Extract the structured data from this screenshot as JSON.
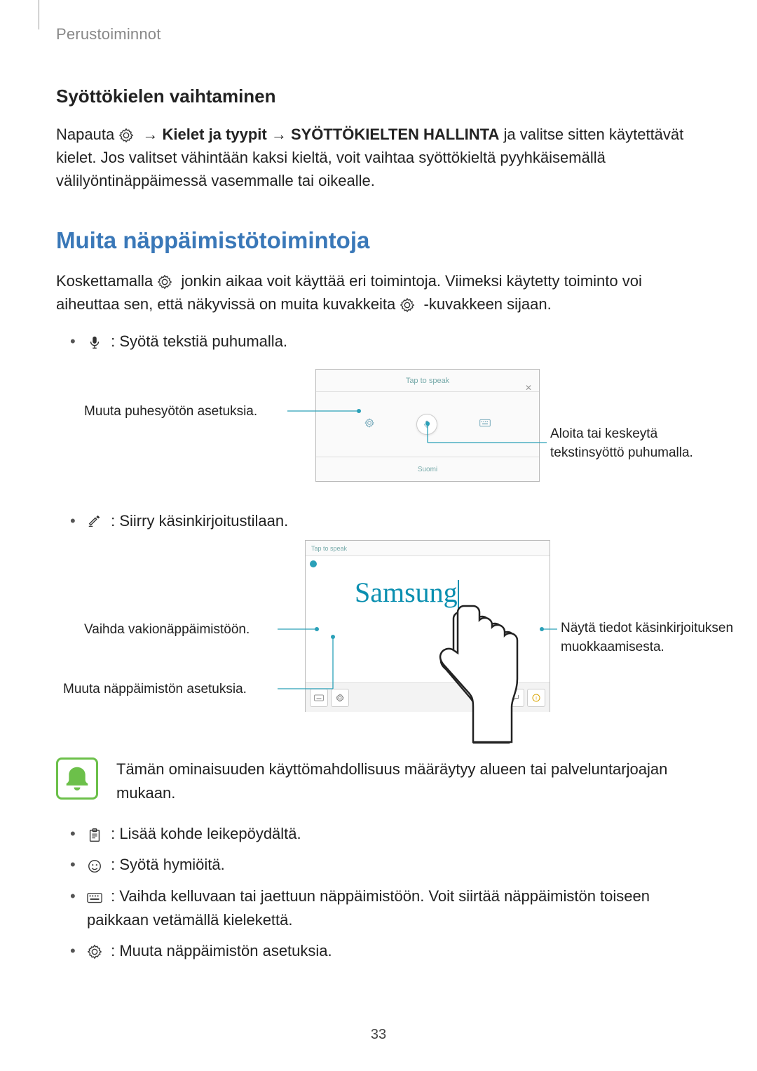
{
  "header": "Perustoiminnot",
  "sub_heading": "Syöttökielen vaihtaminen",
  "p1_a": "Napauta ",
  "p1_b": " → ",
  "p1_bold1": "Kielet ja tyypit",
  "p1_c": " → ",
  "p1_bold2": "SYÖTTÖKIELTEN HALLINTA",
  "p1_d": " ja valitse sitten käytettävät kielet. Jos valitset vähintään kaksi kieltä, voit vaihtaa syöttökieltä pyyhkäisemällä välilyöntinäppäimessä vasemmalle tai oikealle.",
  "section_heading": "Muita näppäimistötoimintoja",
  "p2_a": "Koskettamalla ",
  "p2_b": " jonkin aikaa voit käyttää eri toimintoja. Viimeksi käytetty toiminto voi aiheuttaa sen, että näkyvissä on muita kuvakkeita ",
  "p2_c": "-kuvakkeen sijaan.",
  "li_voice": " : Syötä tekstiä puhumalla.",
  "voice_panel": {
    "top": "Tap to speak",
    "bottom": "Suomi"
  },
  "callouts": {
    "voice_left": "Muuta puhesyötön asetuksia.",
    "voice_right": "Aloita tai keskeytä tekstinsyöttö puhumalla."
  },
  "li_hw": " : Siirry käsinkirjoitustilaan.",
  "hw_panel": {
    "top": "Tap to speak",
    "text": "Samsung"
  },
  "callouts2": {
    "hw_left_top": "Vaihda vakionäppäimistöön.",
    "hw_left_bot": "Muuta näppäimistön asetuksia.",
    "hw_right": "Näytä tiedot käsinkirjoituksen muokkaamisesta."
  },
  "note": "Tämän ominaisuuden käyttömahdollisuus määräytyy alueen tai palveluntarjoajan mukaan.",
  "li_clip": " : Lisää kohde leikepöydältä.",
  "li_emoji": " : Syötä hymiöitä.",
  "li_float": " : Vaihda kelluvaan tai jaettuun näppäimistöön. Voit siirtää näppäimistön toiseen paikkaan vetämällä kielekettä.",
  "li_settings": " : Muuta näppäimistön asetuksia.",
  "page_number": "33"
}
